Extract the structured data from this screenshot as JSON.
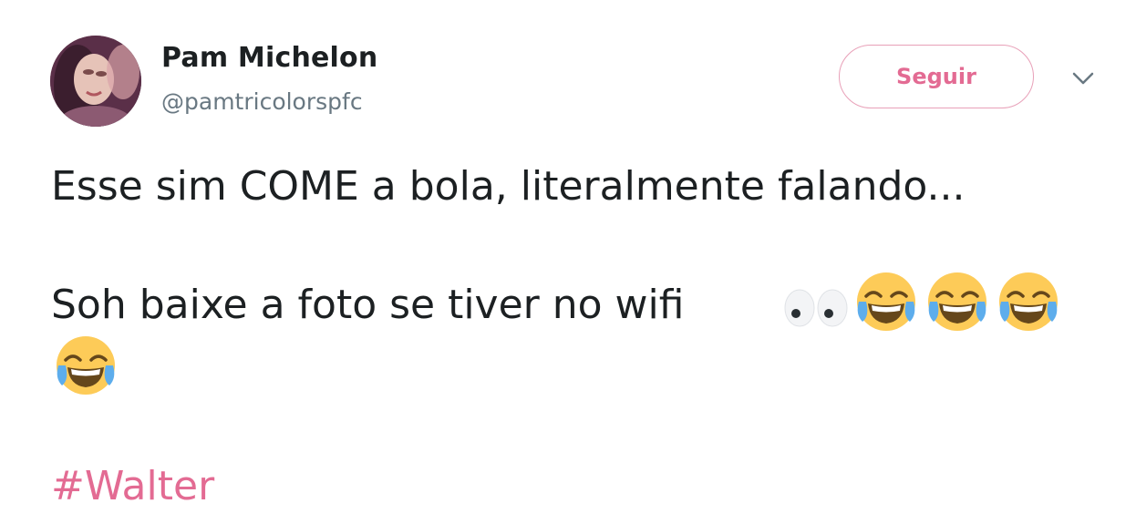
{
  "author": {
    "name": "Pam Michelon",
    "handle": "@pamtricolorspfc"
  },
  "follow_button": {
    "label": "Seguir"
  },
  "tweet": {
    "line1": "Esse sim COME a bola, literalmente falando...",
    "line2": "Soh baixe a foto se tiver no wifi",
    "line2_emojis": [
      "eyes-emoji",
      "tears-of-joy-emoji",
      "tears-of-joy-emoji",
      "tears-of-joy-emoji"
    ],
    "line3_emojis": [
      "tears-of-joy-emoji"
    ],
    "hashtag": "#Walter"
  },
  "colors": {
    "accent": "#e36b93",
    "accent_border": "#e8a0b8",
    "text": "#1c2022",
    "secondary_text": "#697882"
  }
}
